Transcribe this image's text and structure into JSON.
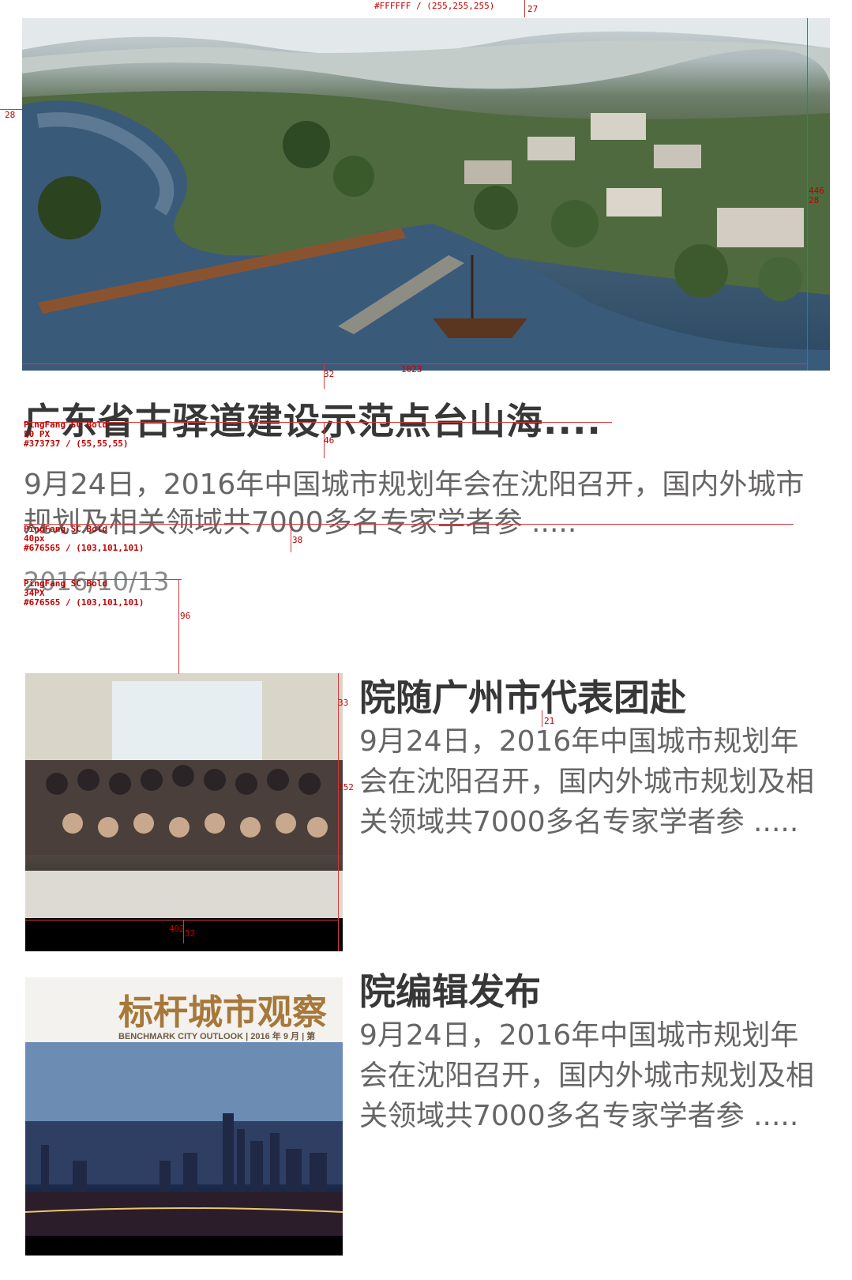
{
  "annotations": {
    "top_color": "#FFFFFF / (255,255,255)",
    "top_gap": "27",
    "left_gap": "28",
    "hero_height": "446",
    "right_gap": "28",
    "title_gap": "32",
    "hero_width": "1023",
    "title_font": "PingFang SC Bold\n50 PX\n#373737 / (55,55,55)",
    "desc_gap": "46",
    "desc_font": "PingFang SC Bold\n40px\n#676565 / (103,101,101)",
    "date_gap": "38",
    "date_font": "PingFang SC Bold\n34PX\n#676565 / (103,101,101)",
    "list_gap": "96",
    "item_title_gap": "33",
    "item_desc_gap": "21",
    "thumb_height": "352",
    "thumb_width": "402",
    "item_gap": "32"
  },
  "hero": {
    "image": "aerial landscape rendering of riverside village",
    "title": "广东省古驿道建设示范点台山海....",
    "description": "9月24日，2016年中国城市规划年会在沈阳召开，国内外城市规划及相关领域共7000多名专家学者参 .....",
    "date": "2016/10/13"
  },
  "items": [
    {
      "image": "group photo of delegation",
      "title": "院随广州市代表团赴",
      "description": "9月24日，2016年中国城市规划年会在沈阳召开，国内外城市规划及相关领域共7000多名专家学者参 ....."
    },
    {
      "image": "magazine cover city skyline",
      "cover_title": "标杆城市观察",
      "cover_subtitle": "BENCHMARK CITY OUTLOOK  | 2016 年 9 月 | 第",
      "title": "院编辑发布",
      "description": "9月24日，2016年中国城市规划年会在沈阳召开，国内外城市规划及相关领域共7000多名专家学者参 ....."
    }
  ],
  "colors": {
    "title": "#373737",
    "text": "#676565",
    "annotation": "#d23a3a",
    "cover_brand": "#a6783a"
  }
}
